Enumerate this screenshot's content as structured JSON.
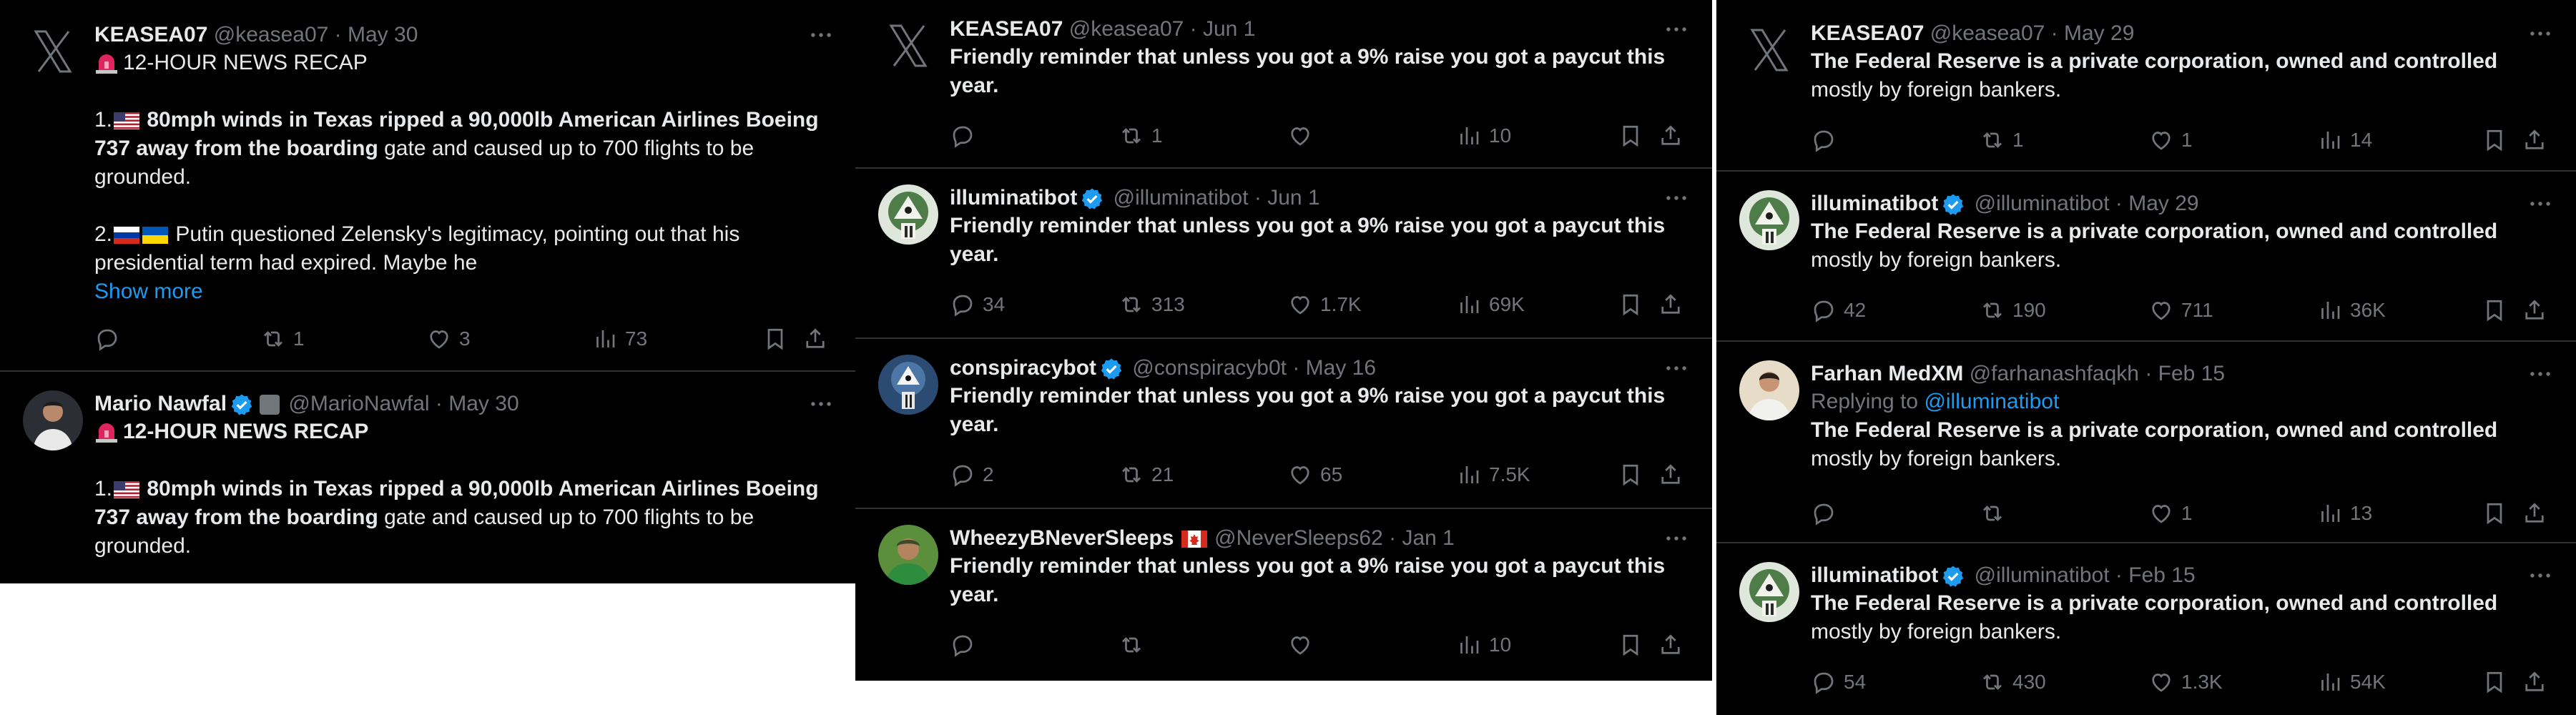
{
  "panels": [
    {
      "tweets": [
        {
          "name": "KEASEA07",
          "handle": "@keasea07",
          "date": "May 30",
          "headline": "12-HOUR NEWS RECAP",
          "item1_bold": "80mph winds in Texas ripped a 90,000lb American Airlines Boeing 737 away from the boarding",
          "item1_rest": " gate and caused up to 700 flights to be grounded.",
          "item2": "Putin questioned Zelensky's legitimacy, pointing out that his presidential term had expired. Maybe he",
          "show_more": "Show more",
          "stats": {
            "replies": "",
            "reposts": "1",
            "likes": "3",
            "views": "73"
          }
        },
        {
          "name": "Mario Nawfal",
          "handle": "@MarioNawfal",
          "date": "May 30",
          "headline": "12-HOUR NEWS RECAP",
          "item1_bold": "80mph winds in Texas ripped a 90,000lb American Airlines Boeing 737 away from the boarding",
          "item1_rest": " gate and caused up to 700 flights to be grounded."
        }
      ]
    },
    {
      "tweets": [
        {
          "name": "KEASEA07",
          "handle": "@keasea07",
          "date": "Jun 1",
          "text": "Friendly reminder that unless you got a 9% raise you got a paycut this year.",
          "stats": {
            "replies": "",
            "reposts": "1",
            "likes": "",
            "views": "10"
          }
        },
        {
          "name": "illuminatibot",
          "handle": "@illuminatibot",
          "date": "Jun 1",
          "text": "Friendly reminder that unless you got a 9% raise you got a paycut this year.",
          "stats": {
            "replies": "34",
            "reposts": "313",
            "likes": "1.7K",
            "views": "69K"
          }
        },
        {
          "name": "conspiracybot",
          "handle": "@conspiracyb0t",
          "date": "May 16",
          "text": "Friendly reminder that unless you got a 9% raise you got a paycut this year.",
          "stats": {
            "replies": "2",
            "reposts": "21",
            "likes": "65",
            "views": "7.5K"
          }
        },
        {
          "name": "WheezyBNeverSleeps",
          "handle": "@NeverSleeps62",
          "date": "Jan 1",
          "text": "Friendly reminder that unless you got a 9% raise you got a paycut this year.",
          "stats": {
            "replies": "",
            "reposts": "",
            "likes": "",
            "views": "10"
          }
        }
      ]
    },
    {
      "tweets": [
        {
          "name": "KEASEA07",
          "handle": "@keasea07",
          "date": "May 29",
          "text_bold": "The Federal Reserve is a private corporation, owned and controlled",
          "text_rest": "mostly by foreign bankers.",
          "stats": {
            "replies": "",
            "reposts": "1",
            "likes": "1",
            "views": "14"
          }
        },
        {
          "name": "illuminatibot",
          "handle": "@illuminatibot",
          "date": "May 29",
          "text_bold": "The Federal Reserve is a private corporation, owned and controlled",
          "text_rest": "mostly by foreign bankers.",
          "stats": {
            "replies": "42",
            "reposts": "190",
            "likes": "711",
            "views": "36K"
          }
        },
        {
          "name": "Farhan MedXM",
          "handle": "@farhanashfaqkh",
          "date": "Feb 15",
          "replying_prefix": "Replying to",
          "replying_to": "@illuminatibot",
          "text_bold": "The Federal Reserve is a private corporation, owned and controlled",
          "text_rest": "mostly by foreign bankers.",
          "stats": {
            "replies": "",
            "reposts": "",
            "likes": "1",
            "views": "13"
          }
        },
        {
          "name": "illuminatibot",
          "handle": "@illuminatibot",
          "date": "Feb 15",
          "text_bold": "The Federal Reserve is a private corporation, owned and controlled",
          "text_rest": "mostly by foreign bankers.",
          "stats": {
            "replies": "54",
            "reposts": "430",
            "likes": "1.3K",
            "views": "54K"
          }
        }
      ]
    }
  ],
  "separator": "·",
  "list_markers": {
    "item1": "1.",
    "item2": "2."
  },
  "colors": {
    "background": "#000000",
    "text": "#e7e9ea",
    "muted": "#71767b",
    "link": "#1d9bf0",
    "verified": "#1d9bf0",
    "divider": "#2f3336"
  }
}
